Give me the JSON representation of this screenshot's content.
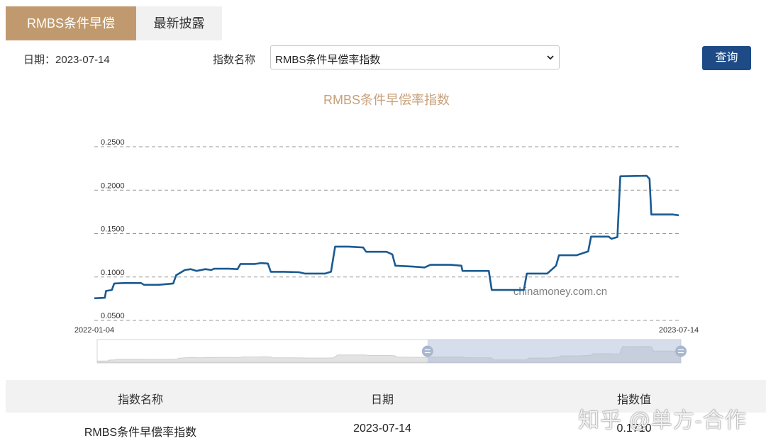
{
  "tabs": [
    {
      "label": "RMBS条件早偿率指数",
      "active": true
    },
    {
      "label": "最新披露",
      "active": false
    }
  ],
  "filters": {
    "date_label": "日期：",
    "date_value": "2023-07-14",
    "index_name_label": "指数名称",
    "index_select_value": "RMBS条件早偿率指数",
    "query_button": "查询"
  },
  "chart_data": {
    "type": "line",
    "title": "RMBS条件早偿率指数",
    "watermark": "chinamoney.com.cn",
    "xlabel": "",
    "ylabel": "",
    "ylim": [
      0.05,
      0.25
    ],
    "y_ticks": [
      "0.0500",
      "0.1000",
      "0.1500",
      "0.2000",
      "0.2500"
    ],
    "x_range_labels": [
      "2022-01-04",
      "2023-07-14"
    ],
    "grid": true,
    "line_color": "#1a5a91",
    "series": [
      {
        "values": [
          [
            0.0,
            0.0755
          ],
          [
            0.018,
            0.076
          ],
          [
            0.02,
            0.084
          ],
          [
            0.03,
            0.085
          ],
          [
            0.034,
            0.0925
          ],
          [
            0.05,
            0.093
          ],
          [
            0.08,
            0.093
          ],
          [
            0.085,
            0.091
          ],
          [
            0.11,
            0.091
          ],
          [
            0.135,
            0.0925
          ],
          [
            0.14,
            0.102
          ],
          [
            0.155,
            0.108
          ],
          [
            0.165,
            0.109
          ],
          [
            0.175,
            0.107
          ],
          [
            0.19,
            0.109
          ],
          [
            0.2,
            0.108
          ],
          [
            0.205,
            0.1095
          ],
          [
            0.23,
            0.1095
          ],
          [
            0.245,
            0.109
          ],
          [
            0.25,
            0.115
          ],
          [
            0.275,
            0.115
          ],
          [
            0.285,
            0.116
          ],
          [
            0.297,
            0.1155
          ],
          [
            0.302,
            0.106
          ],
          [
            0.325,
            0.106
          ],
          [
            0.35,
            0.1055
          ],
          [
            0.36,
            0.104
          ],
          [
            0.395,
            0.104
          ],
          [
            0.405,
            0.106
          ],
          [
            0.412,
            0.135
          ],
          [
            0.435,
            0.135
          ],
          [
            0.46,
            0.134
          ],
          [
            0.465,
            0.129
          ],
          [
            0.5,
            0.129
          ],
          [
            0.51,
            0.126
          ],
          [
            0.515,
            0.113
          ],
          [
            0.545,
            0.112
          ],
          [
            0.565,
            0.111
          ],
          [
            0.575,
            0.114
          ],
          [
            0.61,
            0.114
          ],
          [
            0.628,
            0.113
          ],
          [
            0.63,
            0.107
          ],
          [
            0.675,
            0.107
          ],
          [
            0.68,
            0.085
          ],
          [
            0.735,
            0.085
          ],
          [
            0.74,
            0.104
          ],
          [
            0.775,
            0.104
          ],
          [
            0.79,
            0.113
          ],
          [
            0.795,
            0.125
          ],
          [
            0.825,
            0.125
          ],
          [
            0.845,
            0.1295
          ],
          [
            0.85,
            0.1465
          ],
          [
            0.88,
            0.1465
          ],
          [
            0.885,
            0.144
          ],
          [
            0.895,
            0.146
          ],
          [
            0.9,
            0.216
          ],
          [
            0.945,
            0.2165
          ],
          [
            0.95,
            0.213
          ],
          [
            0.953,
            0.172
          ],
          [
            0.99,
            0.172
          ],
          [
            1.0,
            0.171
          ]
        ]
      }
    ]
  },
  "slider": {
    "selected_start": 0.566,
    "selected_end": 1.0
  },
  "table": {
    "headers": [
      "指数名称",
      "日期",
      "指数值"
    ],
    "rows": [
      [
        "RMBS条件早偿率指数",
        "2023-07-14",
        "0.1710"
      ]
    ]
  },
  "watermark_overlay": "知乎 @单方-合作"
}
